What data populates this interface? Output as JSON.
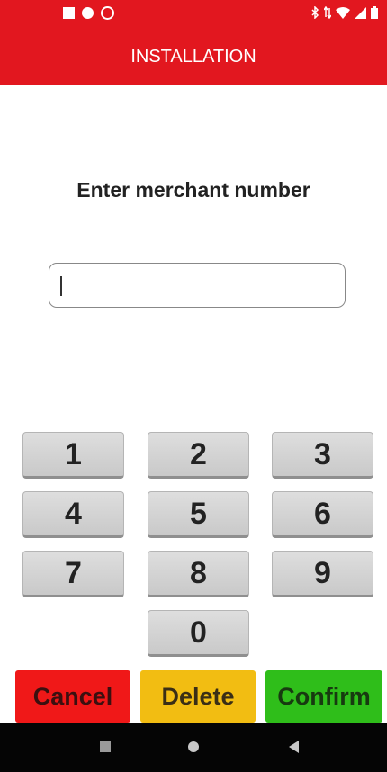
{
  "status_bar": {
    "left_icons": [
      "notification-square-icon",
      "media-circle-icon",
      "sync-circle-icon"
    ],
    "right_icons": [
      "bluetooth-icon",
      "data-arrows-icon",
      "wifi-icon",
      "signal-icon",
      "battery-icon"
    ]
  },
  "header": {
    "title": "INSTALLATION"
  },
  "prompt": "Enter merchant number",
  "input": {
    "value": "",
    "placeholder": ""
  },
  "keypad": {
    "keys": [
      "1",
      "2",
      "3",
      "4",
      "5",
      "6",
      "7",
      "8",
      "9",
      "0"
    ]
  },
  "actions": {
    "cancel": "Cancel",
    "delete": "Delete",
    "confirm": "Confirm"
  },
  "nav": {
    "icons": [
      "recents-square-icon",
      "home-circle-icon",
      "back-triangle-icon"
    ]
  },
  "colors": {
    "header_red": "#e2171f",
    "cancel_red": "#f01818",
    "delete_yellow": "#f2bd12",
    "confirm_green": "#2fbe1a",
    "nav_black": "#050505"
  }
}
